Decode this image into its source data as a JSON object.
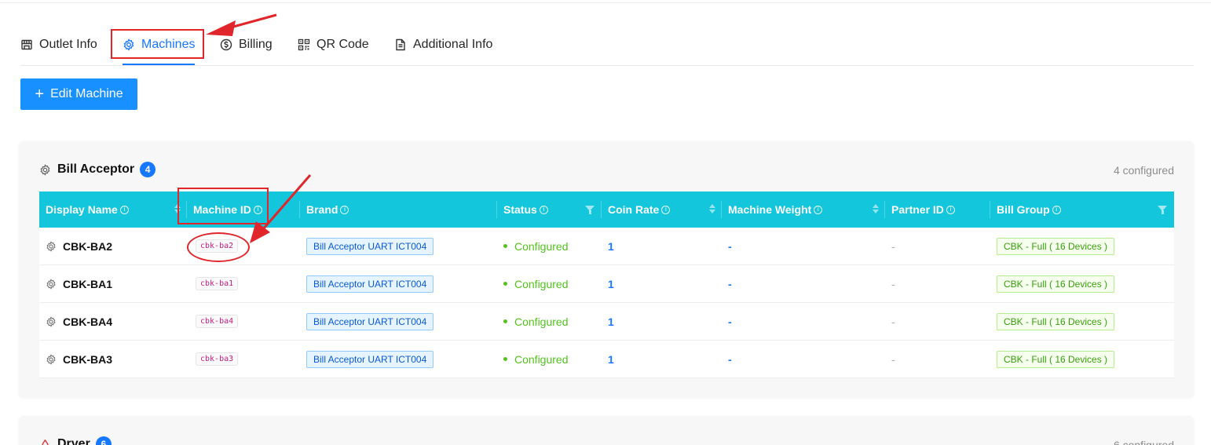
{
  "tabs": [
    {
      "label": "Outlet Info",
      "icon": "store-icon"
    },
    {
      "label": "Machines",
      "icon": "gear-icon",
      "active": true
    },
    {
      "label": "Billing",
      "icon": "dollar-icon"
    },
    {
      "label": "QR Code",
      "icon": "qrcode-icon"
    },
    {
      "label": "Additional Info",
      "icon": "document-icon"
    }
  ],
  "toolbar": {
    "edit_label": "Edit Machine",
    "edit_icon": "plus-icon"
  },
  "bill_acceptor": {
    "title": "Bill Acceptor",
    "count": "4",
    "configured_label": "4 configured",
    "columns": [
      "Display Name",
      "Machine ID",
      "Brand",
      "Status",
      "Coin Rate",
      "Machine Weight",
      "Partner ID",
      "Bill Group"
    ],
    "rows": [
      {
        "display_name": "CBK-BA2",
        "machine_id": "cbk-ba2",
        "brand": "Bill Acceptor UART ICT004",
        "status": "Configured",
        "coin_rate": "1",
        "weight": "-",
        "partner_id": "-",
        "bill_group": "CBK - Full ( 16 Devices )"
      },
      {
        "display_name": "CBK-BA1",
        "machine_id": "cbk-ba1",
        "brand": "Bill Acceptor UART ICT004",
        "status": "Configured",
        "coin_rate": "1",
        "weight": "-",
        "partner_id": "-",
        "bill_group": "CBK - Full ( 16 Devices )"
      },
      {
        "display_name": "CBK-BA4",
        "machine_id": "cbk-ba4",
        "brand": "Bill Acceptor UART ICT004",
        "status": "Configured",
        "coin_rate": "1",
        "weight": "-",
        "partner_id": "-",
        "bill_group": "CBK - Full ( 16 Devices )"
      },
      {
        "display_name": "CBK-BA3",
        "machine_id": "cbk-ba3",
        "brand": "Bill Acceptor UART ICT004",
        "status": "Configured",
        "coin_rate": "1",
        "weight": "-",
        "partner_id": "-",
        "bill_group": "CBK - Full ( 16 Devices )"
      }
    ]
  },
  "dryer": {
    "title": "Dryer",
    "count": "6",
    "configured_label": "6 configured"
  },
  "colors": {
    "accent": "#1677ff",
    "header": "#13c6dc",
    "status": "#52c41a",
    "annotation": "#e0262b"
  }
}
